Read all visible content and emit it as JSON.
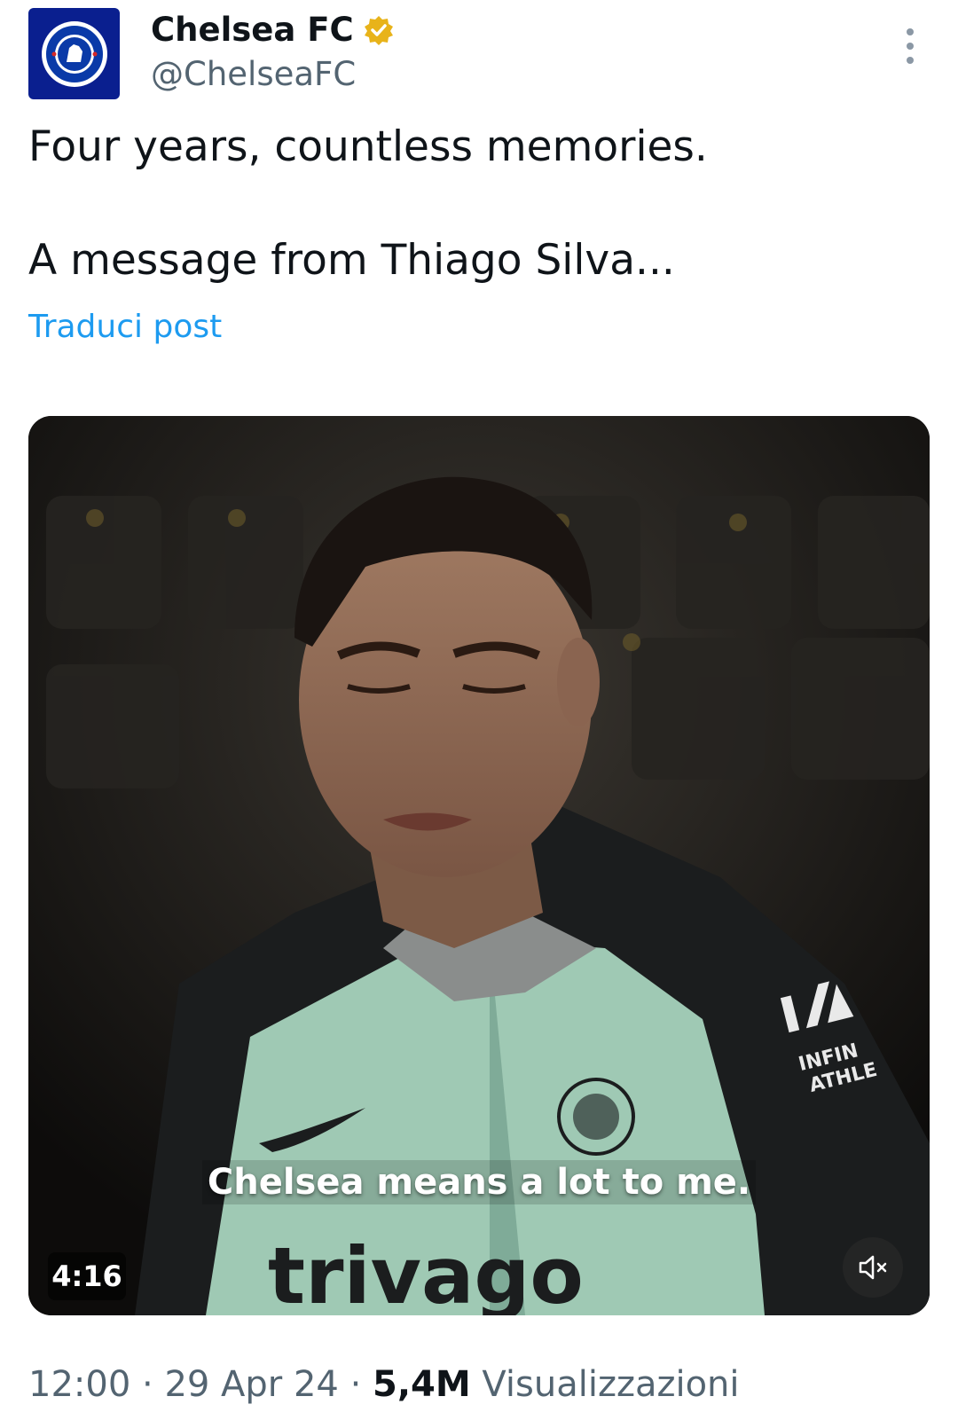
{
  "author": {
    "name": "Chelsea FC",
    "handle": "@ChelseaFC",
    "verified": true,
    "avatar_icon": "chelsea-crest-icon"
  },
  "post": {
    "line1": "Four years, countless memories.",
    "line2": "A message from Thiago Silva...",
    "translate_label": "Traduci post"
  },
  "video": {
    "caption": "Chelsea means a lot to me.",
    "duration": "4:16",
    "muted": true
  },
  "meta": {
    "time": "12:00",
    "separator": "·",
    "date": "29 Apr 24",
    "views_count": "5,4M",
    "views_label": "Visualizzazioni"
  },
  "colors": {
    "link": "#1d9bf0",
    "secondary_text": "#536471",
    "verified_badge": "#e8b31a",
    "avatar_bg": "#0a1f8f"
  }
}
